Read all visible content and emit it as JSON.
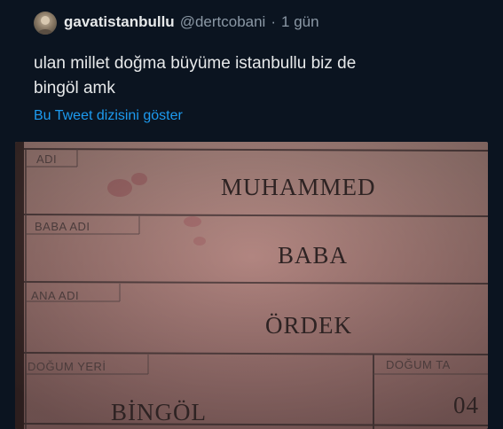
{
  "tweet": {
    "display_name": "gavatistanbullu",
    "handle": "@dertcobani",
    "separator": "·",
    "time": "1 gün",
    "text_line1": "ulan millet doğma büyüme istanbullu biz de",
    "text_line2": "bingöl amk",
    "show_thread": "Bu Tweet dizisini göster"
  },
  "id_card": {
    "field_name_label": "ADI",
    "field_name_value": "MUHAMMED",
    "field_father_label": "BABA ADI",
    "field_father_value": "BABA",
    "field_mother_label": "ANA ADI",
    "field_mother_value": "ÖRDEK",
    "field_birthplace_label": "DOĞUM YERİ",
    "field_birthplace_value": "BİNGÖL",
    "field_birthdate_label": "DOĞUM TA",
    "field_birthdate_value": "04"
  },
  "colors": {
    "background": "#0b1420",
    "link": "#1d9bf0",
    "text_primary": "#e7e9ea",
    "text_secondary": "#8b98a5"
  }
}
